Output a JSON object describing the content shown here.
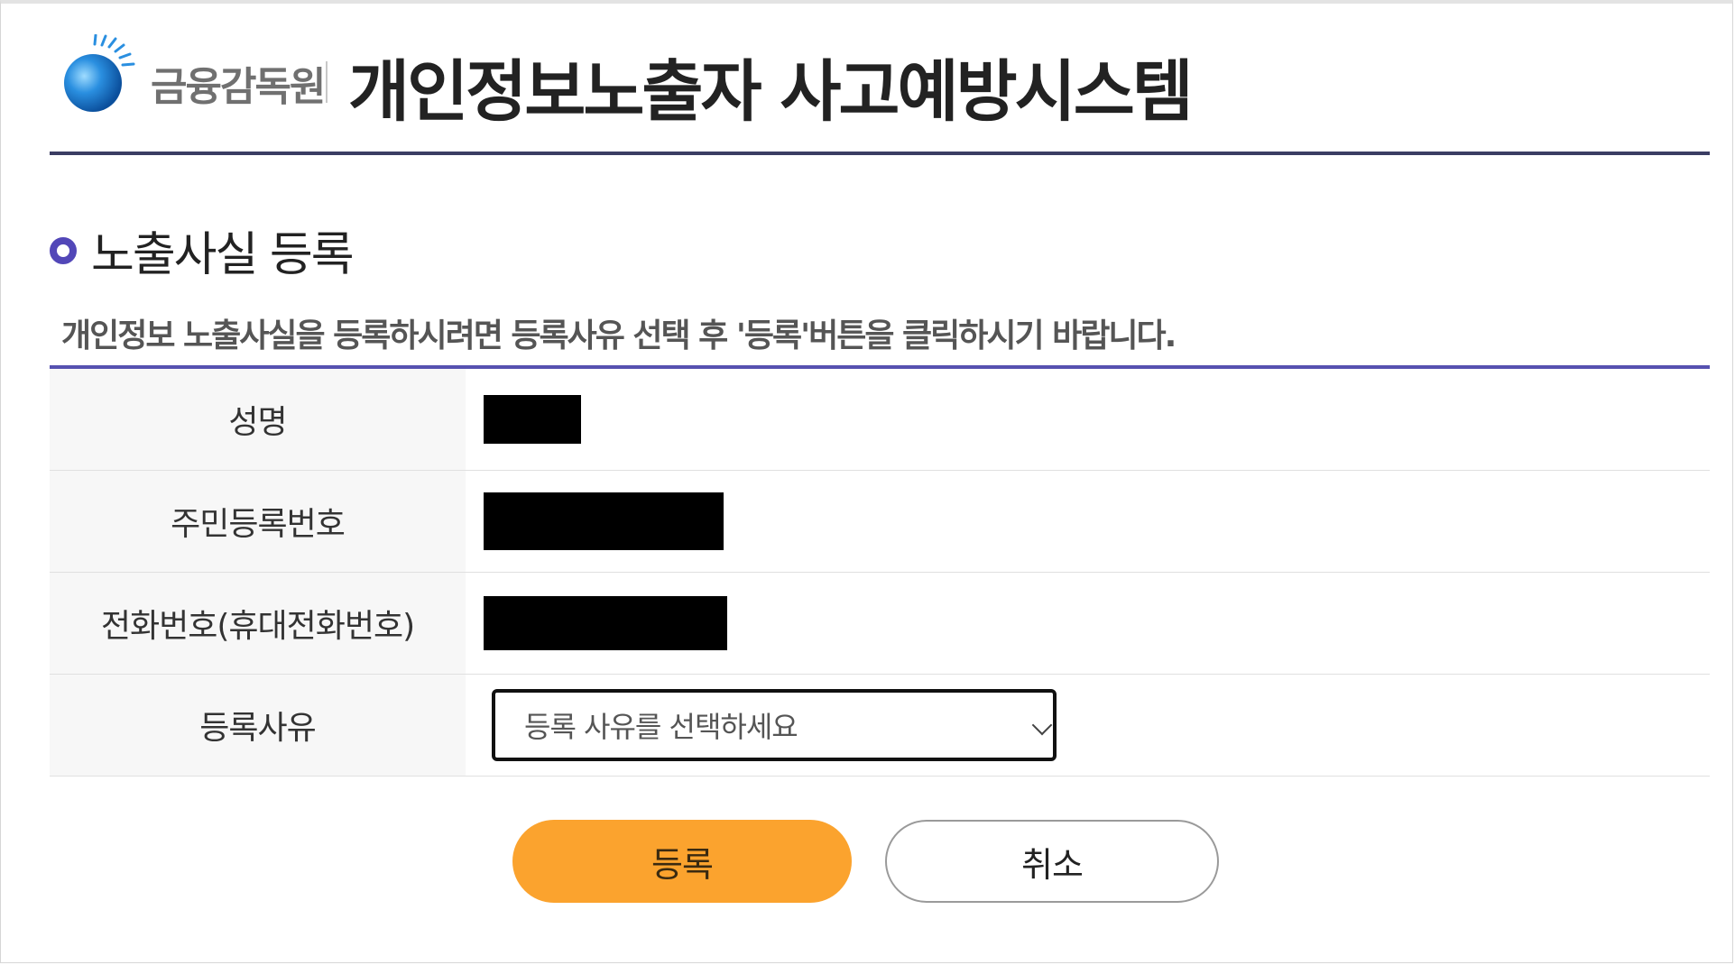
{
  "header": {
    "org_name": "금융감독원",
    "system_title": "개인정보노출자 사고예방시스템"
  },
  "section": {
    "title": "노출사실 등록",
    "instruction": "개인정보 노출사실을 등록하시려면 등록사유 선택 후 '등록'버튼을 클릭하시기 바랍니다."
  },
  "form": {
    "rows": [
      {
        "label": "성명"
      },
      {
        "label": "주민등록번호"
      },
      {
        "label": "전화번호(휴대전화번호)"
      },
      {
        "label": "등록사유"
      }
    ],
    "reason_select": {
      "value": "등록 사유를 선택하세요"
    }
  },
  "buttons": {
    "register_label": "등록",
    "cancel_label": "취소"
  },
  "colors": {
    "header_rule": "#3b3d63",
    "accent_purple": "#5247b8",
    "register_button": "#fba32e",
    "label_bg": "#f7f7f7"
  },
  "icons": {
    "logo": "fss-globe-logo",
    "section_marker": "ring-icon",
    "select_arrow": "chevron-down-icon"
  }
}
